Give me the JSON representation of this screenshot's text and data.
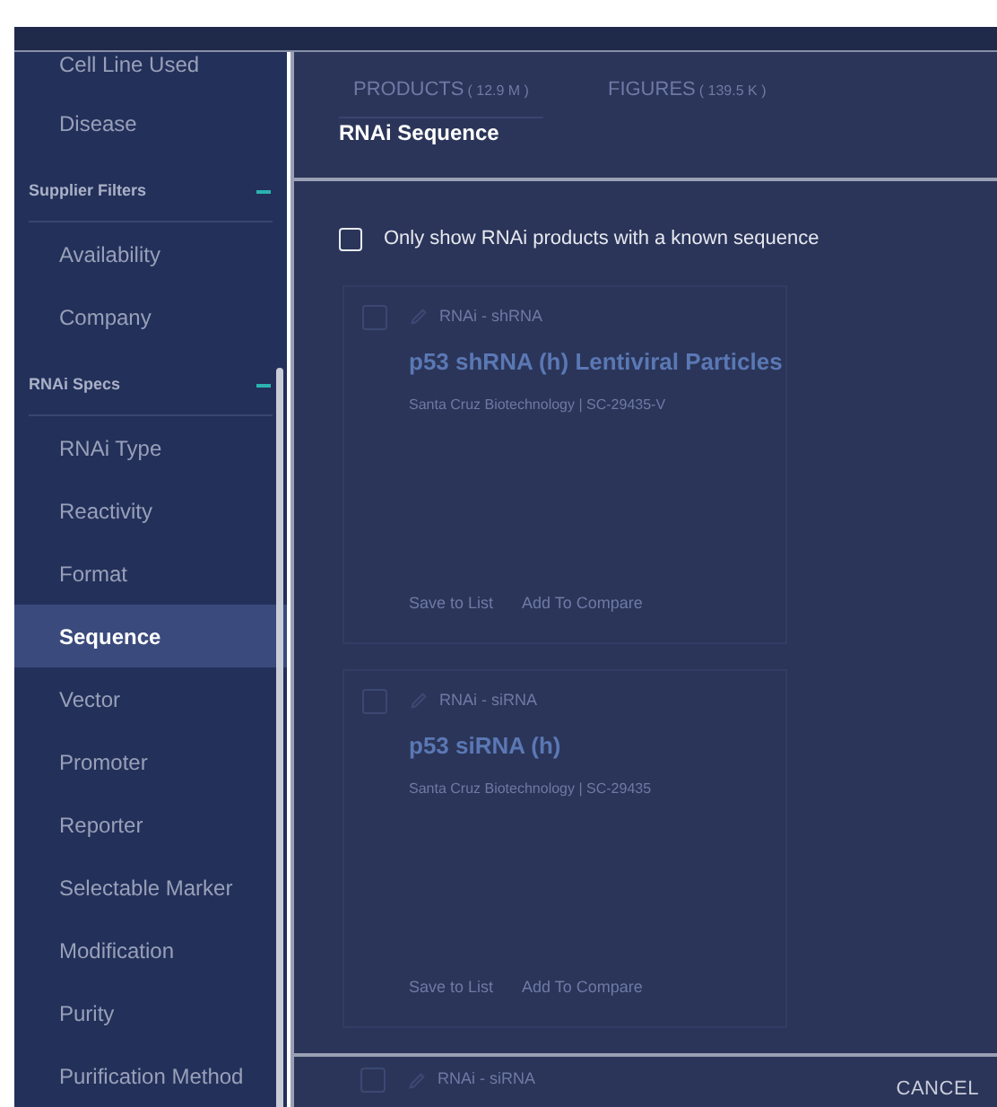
{
  "sidebar": {
    "items": [
      {
        "kind": "item",
        "label": "Cell Line Used",
        "selected": false
      },
      {
        "kind": "item",
        "label": "Disease",
        "selected": false
      },
      {
        "kind": "group",
        "label": "Supplier Filters",
        "expanded": true
      },
      {
        "kind": "item",
        "label": "Availability",
        "selected": false
      },
      {
        "kind": "item",
        "label": "Company",
        "selected": false
      },
      {
        "kind": "group",
        "label": "RNAi Specs",
        "expanded": true
      },
      {
        "kind": "item",
        "label": "RNAi Type",
        "selected": false
      },
      {
        "kind": "item",
        "label": "Reactivity",
        "selected": false
      },
      {
        "kind": "item",
        "label": "Format",
        "selected": false
      },
      {
        "kind": "item",
        "label": "Sequence",
        "selected": true
      },
      {
        "kind": "item",
        "label": "Vector",
        "selected": false
      },
      {
        "kind": "item",
        "label": "Promoter",
        "selected": false
      },
      {
        "kind": "item",
        "label": "Reporter",
        "selected": false
      },
      {
        "kind": "item",
        "label": "Selectable Marker",
        "selected": false
      },
      {
        "kind": "item",
        "label": "Modification",
        "selected": false
      },
      {
        "kind": "item",
        "label": "Purity",
        "selected": false
      },
      {
        "kind": "item",
        "label": "Purification Method",
        "selected": false
      }
    ]
  },
  "background_tabs": [
    {
      "label": "PRODUCTS",
      "count": "( 12.9 M )",
      "selected": true
    },
    {
      "label": "FIGURES",
      "count": "( 139.5 K )",
      "selected": false
    }
  ],
  "dialog": {
    "title": "RNAi Sequence",
    "checkbox": {
      "label": "Only show RNAi products with a known sequence",
      "checked": false
    },
    "cancel": "CANCEL"
  },
  "background_cards": [
    {
      "type": "RNAi - shRNA",
      "title": "p53 shRNA (h) Lentiviral Particles",
      "source": "Santa Cruz Biotechnology | SC-29435-V",
      "actions": [
        "Save to List",
        "Add To Compare"
      ],
      "checked": false
    },
    {
      "type": "RNAi - siRNA",
      "title": "p53 siRNA (h)",
      "source": "Santa Cruz Biotechnology | SC-29435",
      "actions": [
        "Save to List",
        "Add To Compare"
      ],
      "checked": false
    }
  ],
  "background_card_peek": {
    "type": "RNAi - siRNA",
    "checked": false
  }
}
